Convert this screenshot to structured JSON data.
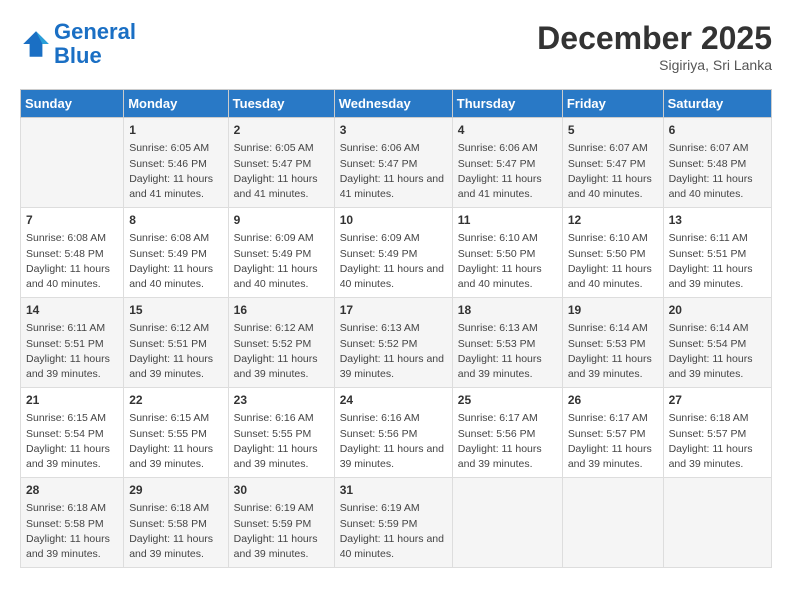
{
  "header": {
    "logo_line1": "General",
    "logo_line2": "Blue",
    "month_title": "December 2025",
    "location": "Sigiriya, Sri Lanka"
  },
  "days_of_week": [
    "Sunday",
    "Monday",
    "Tuesday",
    "Wednesday",
    "Thursday",
    "Friday",
    "Saturday"
  ],
  "weeks": [
    [
      {
        "day": "",
        "info": ""
      },
      {
        "day": "1",
        "sunrise": "Sunrise: 6:05 AM",
        "sunset": "Sunset: 5:46 PM",
        "daylight": "Daylight: 11 hours and 41 minutes."
      },
      {
        "day": "2",
        "sunrise": "Sunrise: 6:05 AM",
        "sunset": "Sunset: 5:47 PM",
        "daylight": "Daylight: 11 hours and 41 minutes."
      },
      {
        "day": "3",
        "sunrise": "Sunrise: 6:06 AM",
        "sunset": "Sunset: 5:47 PM",
        "daylight": "Daylight: 11 hours and 41 minutes."
      },
      {
        "day": "4",
        "sunrise": "Sunrise: 6:06 AM",
        "sunset": "Sunset: 5:47 PM",
        "daylight": "Daylight: 11 hours and 41 minutes."
      },
      {
        "day": "5",
        "sunrise": "Sunrise: 6:07 AM",
        "sunset": "Sunset: 5:47 PM",
        "daylight": "Daylight: 11 hours and 40 minutes."
      },
      {
        "day": "6",
        "sunrise": "Sunrise: 6:07 AM",
        "sunset": "Sunset: 5:48 PM",
        "daylight": "Daylight: 11 hours and 40 minutes."
      }
    ],
    [
      {
        "day": "7",
        "sunrise": "Sunrise: 6:08 AM",
        "sunset": "Sunset: 5:48 PM",
        "daylight": "Daylight: 11 hours and 40 minutes."
      },
      {
        "day": "8",
        "sunrise": "Sunrise: 6:08 AM",
        "sunset": "Sunset: 5:49 PM",
        "daylight": "Daylight: 11 hours and 40 minutes."
      },
      {
        "day": "9",
        "sunrise": "Sunrise: 6:09 AM",
        "sunset": "Sunset: 5:49 PM",
        "daylight": "Daylight: 11 hours and 40 minutes."
      },
      {
        "day": "10",
        "sunrise": "Sunrise: 6:09 AM",
        "sunset": "Sunset: 5:49 PM",
        "daylight": "Daylight: 11 hours and 40 minutes."
      },
      {
        "day": "11",
        "sunrise": "Sunrise: 6:10 AM",
        "sunset": "Sunset: 5:50 PM",
        "daylight": "Daylight: 11 hours and 40 minutes."
      },
      {
        "day": "12",
        "sunrise": "Sunrise: 6:10 AM",
        "sunset": "Sunset: 5:50 PM",
        "daylight": "Daylight: 11 hours and 40 minutes."
      },
      {
        "day": "13",
        "sunrise": "Sunrise: 6:11 AM",
        "sunset": "Sunset: 5:51 PM",
        "daylight": "Daylight: 11 hours and 39 minutes."
      }
    ],
    [
      {
        "day": "14",
        "sunrise": "Sunrise: 6:11 AM",
        "sunset": "Sunset: 5:51 PM",
        "daylight": "Daylight: 11 hours and 39 minutes."
      },
      {
        "day": "15",
        "sunrise": "Sunrise: 6:12 AM",
        "sunset": "Sunset: 5:51 PM",
        "daylight": "Daylight: 11 hours and 39 minutes."
      },
      {
        "day": "16",
        "sunrise": "Sunrise: 6:12 AM",
        "sunset": "Sunset: 5:52 PM",
        "daylight": "Daylight: 11 hours and 39 minutes."
      },
      {
        "day": "17",
        "sunrise": "Sunrise: 6:13 AM",
        "sunset": "Sunset: 5:52 PM",
        "daylight": "Daylight: 11 hours and 39 minutes."
      },
      {
        "day": "18",
        "sunrise": "Sunrise: 6:13 AM",
        "sunset": "Sunset: 5:53 PM",
        "daylight": "Daylight: 11 hours and 39 minutes."
      },
      {
        "day": "19",
        "sunrise": "Sunrise: 6:14 AM",
        "sunset": "Sunset: 5:53 PM",
        "daylight": "Daylight: 11 hours and 39 minutes."
      },
      {
        "day": "20",
        "sunrise": "Sunrise: 6:14 AM",
        "sunset": "Sunset: 5:54 PM",
        "daylight": "Daylight: 11 hours and 39 minutes."
      }
    ],
    [
      {
        "day": "21",
        "sunrise": "Sunrise: 6:15 AM",
        "sunset": "Sunset: 5:54 PM",
        "daylight": "Daylight: 11 hours and 39 minutes."
      },
      {
        "day": "22",
        "sunrise": "Sunrise: 6:15 AM",
        "sunset": "Sunset: 5:55 PM",
        "daylight": "Daylight: 11 hours and 39 minutes."
      },
      {
        "day": "23",
        "sunrise": "Sunrise: 6:16 AM",
        "sunset": "Sunset: 5:55 PM",
        "daylight": "Daylight: 11 hours and 39 minutes."
      },
      {
        "day": "24",
        "sunrise": "Sunrise: 6:16 AM",
        "sunset": "Sunset: 5:56 PM",
        "daylight": "Daylight: 11 hours and 39 minutes."
      },
      {
        "day": "25",
        "sunrise": "Sunrise: 6:17 AM",
        "sunset": "Sunset: 5:56 PM",
        "daylight": "Daylight: 11 hours and 39 minutes."
      },
      {
        "day": "26",
        "sunrise": "Sunrise: 6:17 AM",
        "sunset": "Sunset: 5:57 PM",
        "daylight": "Daylight: 11 hours and 39 minutes."
      },
      {
        "day": "27",
        "sunrise": "Sunrise: 6:18 AM",
        "sunset": "Sunset: 5:57 PM",
        "daylight": "Daylight: 11 hours and 39 minutes."
      }
    ],
    [
      {
        "day": "28",
        "sunrise": "Sunrise: 6:18 AM",
        "sunset": "Sunset: 5:58 PM",
        "daylight": "Daylight: 11 hours and 39 minutes."
      },
      {
        "day": "29",
        "sunrise": "Sunrise: 6:18 AM",
        "sunset": "Sunset: 5:58 PM",
        "daylight": "Daylight: 11 hours and 39 minutes."
      },
      {
        "day": "30",
        "sunrise": "Sunrise: 6:19 AM",
        "sunset": "Sunset: 5:59 PM",
        "daylight": "Daylight: 11 hours and 39 minutes."
      },
      {
        "day": "31",
        "sunrise": "Sunrise: 6:19 AM",
        "sunset": "Sunset: 5:59 PM",
        "daylight": "Daylight: 11 hours and 40 minutes."
      },
      {
        "day": "",
        "info": ""
      },
      {
        "day": "",
        "info": ""
      },
      {
        "day": "",
        "info": ""
      }
    ]
  ]
}
